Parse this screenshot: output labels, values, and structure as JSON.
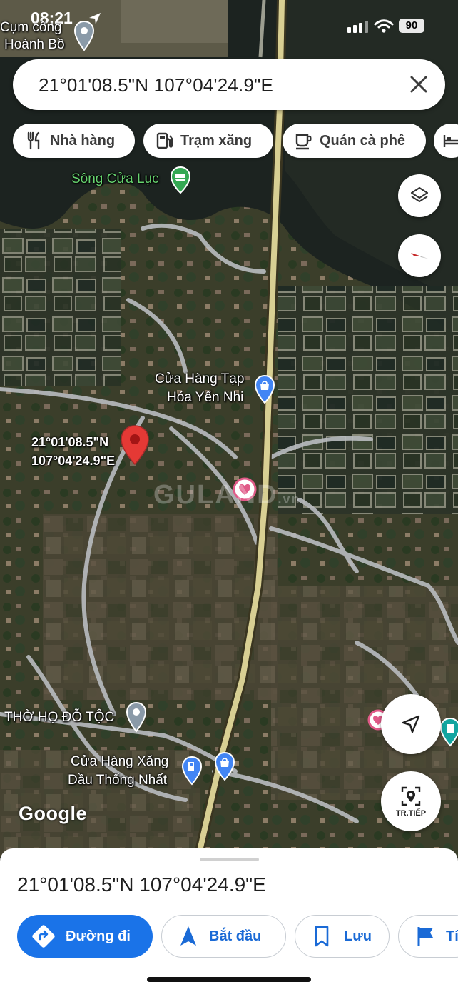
{
  "status_bar": {
    "time": "08:21",
    "battery": "90"
  },
  "search": {
    "query": "21°01'08.5\"N 107°04'24.9\"E"
  },
  "chips": [
    {
      "label": "Nhà hàng",
      "icon": "restaurant-icon"
    },
    {
      "label": "Trạm xăng",
      "icon": "gas-station-icon"
    },
    {
      "label": "Quán cà phê",
      "icon": "coffee-icon"
    },
    {
      "label": "",
      "icon": "hotel-icon"
    }
  ],
  "map": {
    "labels": {
      "cum_cong": "Cụm công",
      "hoanh_bo": "Hoành Bồ",
      "song_cua_luc": "Sông Cửa Lục",
      "cua_hang_tap_hoa_1": "Cửa Hàng Tạp",
      "cua_hang_tap_hoa_2": "Hóa Yến Nhi",
      "pin_coord_1": "21°01'08.5\"N",
      "pin_coord_2": "107°04'24.9\"E",
      "tho_ho": "THỜ HỌ ĐỖ TỘC",
      "cua_hang_xang_1": "Cửa Hàng Xăng",
      "cua_hang_xang_2": "Dầu Thống Nhất"
    },
    "attribution": "Google",
    "watermark": "GULAND",
    "watermark_suffix": ".vn"
  },
  "controls": {
    "next_label": "TR.TIẾP"
  },
  "sheet": {
    "title": "21°01'08.5\"N 107°04'24.9\"E",
    "actions": [
      {
        "label": "Đường đi",
        "icon": "directions-icon"
      },
      {
        "label": "Bắt đầu",
        "icon": "navigation-arrow-icon"
      },
      {
        "label": "Lưu",
        "icon": "bookmark-icon"
      },
      {
        "label": "Tí",
        "icon": "flag-icon"
      }
    ]
  },
  "colors": {
    "accent": "#1a73e8",
    "pin": "#e53935",
    "road": "#d8cf93"
  }
}
